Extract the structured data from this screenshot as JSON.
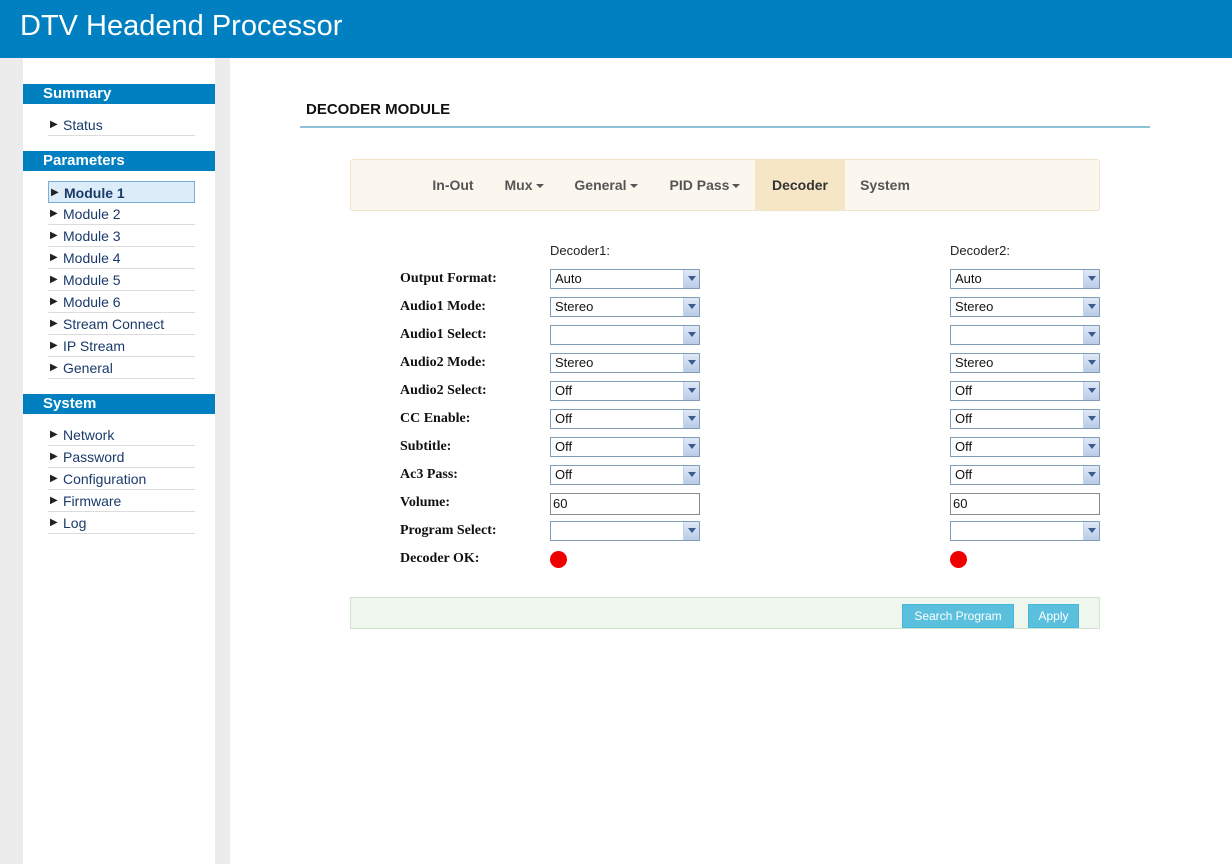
{
  "header": {
    "title": "DTV Headend Processor"
  },
  "sidebar": {
    "summary": {
      "title": "Summary",
      "items": [
        {
          "label": "Status"
        }
      ]
    },
    "parameters": {
      "title": "Parameters",
      "items": [
        {
          "label": "Module 1"
        },
        {
          "label": "Module 2"
        },
        {
          "label": "Module 3"
        },
        {
          "label": "Module 4"
        },
        {
          "label": "Module 5"
        },
        {
          "label": "Module 6"
        },
        {
          "label": "Stream Connect"
        },
        {
          "label": "IP Stream"
        },
        {
          "label": "General"
        }
      ]
    },
    "system": {
      "title": "System",
      "items": [
        {
          "label": "Network"
        },
        {
          "label": "Password"
        },
        {
          "label": "Configuration"
        },
        {
          "label": "Firmware"
        },
        {
          "label": "Log"
        }
      ]
    }
  },
  "main": {
    "title": "DECODER MODULE",
    "tabs": [
      {
        "label": "In-Out"
      },
      {
        "label": "Mux"
      },
      {
        "label": "General"
      },
      {
        "label": "PID Pass"
      },
      {
        "label": "Decoder"
      },
      {
        "label": "System"
      }
    ],
    "columns": {
      "decoder1": "Decoder1:",
      "decoder2": "Decoder2:"
    },
    "rows": {
      "output_format": {
        "label": "Output Format:",
        "d1": "Auto",
        "d2": "Auto"
      },
      "audio1_mode": {
        "label": "Audio1 Mode:",
        "d1": "Stereo",
        "d2": "Stereo"
      },
      "audio1_select": {
        "label": "Audio1 Select:",
        "d1": "",
        "d2": ""
      },
      "audio2_mode": {
        "label": "Audio2 Mode:",
        "d1": "Stereo",
        "d2": "Stereo"
      },
      "audio2_select": {
        "label": "Audio2 Select:",
        "d1": "Off",
        "d2": "Off"
      },
      "cc_enable": {
        "label": "CC Enable:",
        "d1": "Off",
        "d2": "Off"
      },
      "subtitle": {
        "label": "Subtitle:",
        "d1": "Off",
        "d2": "Off"
      },
      "ac3_pass": {
        "label": "Ac3 Pass:",
        "d1": "Off",
        "d2": "Off"
      },
      "volume": {
        "label": "Volume:",
        "d1": "60",
        "d2": "60"
      },
      "program_select": {
        "label": "Program Select:",
        "d1": "",
        "d2": ""
      },
      "decoder_ok": {
        "label": "Decoder OK:",
        "d1_status_color": "#ee0000",
        "d2_status_color": "#ee0000"
      }
    },
    "buttons": {
      "search_program": "Search Program",
      "apply": "Apply"
    }
  }
}
